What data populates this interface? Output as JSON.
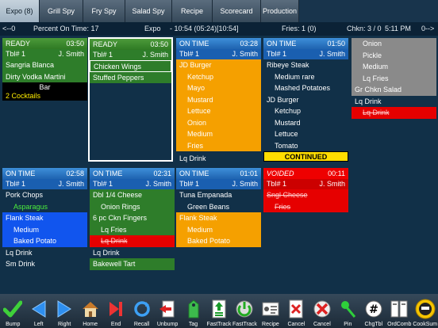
{
  "tabs": [
    "Expo (8)",
    "Grill Spy",
    "Fry Spy",
    "Salad Spy",
    "Recipe",
    "Scorecard",
    "Production"
  ],
  "info": {
    "left_arrow": "<--0",
    "percent": "Percent On Time: 17",
    "expo": "Expo",
    "time_range": "- 10:54 (05:24)[10:54]",
    "fries": "Fries: 1 (0)",
    "chkn": "Chkn: 3 / 0",
    "clock": "5:11 PM",
    "right_arrow": "0-->"
  },
  "cards": {
    "c1": {
      "status": "READY",
      "time": "03:50",
      "table": "Tbl# 1",
      "server": "J. Smith",
      "items": [
        "Sangria Blanca",
        "Dirty Vodka Martini"
      ],
      "bar_label": "Bar",
      "bar_note": "2 Cocktails"
    },
    "c2": {
      "status": "READY",
      "time": "03:50",
      "table": "Tbl# 1",
      "server": "J. Smith",
      "items": [
        "Chicken Wings",
        "Stuffed Peppers"
      ]
    },
    "c3": {
      "status": "ON TIME",
      "time": "03:28",
      "table": "Tbl# 1",
      "server": "J. Smith",
      "items": [
        "JD Burger",
        "Ketchup",
        "Mayo",
        "Mustard",
        "Lettuce",
        "Onion",
        "Medium",
        "Fries",
        "Lq Drink"
      ]
    },
    "c4": {
      "status": "ON TIME",
      "time": "01:50",
      "table": "Tbl# 1",
      "server": "J. Smith",
      "items": [
        "Ribeye Steak",
        "Medium rare",
        "Mashed Potatoes",
        "JD Burger",
        "Ketchup",
        "Mustard",
        "Lettuce",
        "Tomato"
      ],
      "continued": "CONTINUED"
    },
    "c5": {
      "items": [
        "Onion",
        "Pickle",
        "Medium",
        "Lq Fries",
        "Gr Chkn Salad",
        "Lq Drink",
        "Lq Drink"
      ]
    },
    "c6": {
      "status": "ON TIME",
      "time": "02:58",
      "table": "Tbl# 1",
      "server": "J. Smith",
      "items": [
        "Pork Chops",
        "Asparagus",
        "Flank Steak",
        "Medium",
        "Baked Potato",
        "Lq Drink",
        "Sm Drink"
      ]
    },
    "c7": {
      "status": "ON TIME",
      "time": "02:31",
      "table": "Tbl# 1",
      "server": "J. Smith",
      "items": [
        "Dbl 1/4 Cheese",
        "Onion Rings",
        "6 pc Ckn Fingers",
        "Lq Fries",
        "Lq Drink",
        "Lq Drink",
        "Bakewell Tart"
      ]
    },
    "c8": {
      "status": "ON TIME",
      "time": "01:01",
      "table": "Tbl# 1",
      "server": "J. Smith",
      "items": [
        "Tuna Empanada",
        "Green Beans",
        "Flank Steak",
        "Medium",
        "Baked Potato"
      ]
    },
    "c9": {
      "status": "VOIDED",
      "time": "00:11",
      "table": "Tbl# 1",
      "server": "J. Smith",
      "items": [
        "Sngl Cheese",
        "Fries"
      ]
    }
  },
  "toolbar": [
    {
      "label": "Bump",
      "icon": "check-icon"
    },
    {
      "label": "Left",
      "icon": "arrow-left-icon"
    },
    {
      "label": "Right",
      "icon": "arrow-right-icon"
    },
    {
      "label": "Home",
      "icon": "house-icon"
    },
    {
      "label": "End",
      "icon": "end-icon"
    },
    {
      "label": "Recall",
      "icon": "recall-icon"
    },
    {
      "label": "Unbump",
      "icon": "unbump-icon"
    },
    {
      "label": "Tag",
      "icon": "tag-icon"
    },
    {
      "label": "FastTrack",
      "icon": "fasttrack-icon"
    },
    {
      "label": "FastTrack",
      "icon": "fasttrack-power-icon"
    },
    {
      "label": "Recipe",
      "icon": "recipe-icon"
    },
    {
      "label": "Cancel",
      "icon": "cancel-doc-icon"
    },
    {
      "label": "Cancel",
      "icon": "cancel-x-icon"
    },
    {
      "label": "Pin",
      "icon": "pin-icon"
    },
    {
      "label": "ChgTbl",
      "icon": "hash-icon"
    },
    {
      "label": "OrdComb",
      "icon": "ordcomb-icon"
    },
    {
      "label": "CookSum",
      "icon": "cooksum-icon"
    }
  ]
}
